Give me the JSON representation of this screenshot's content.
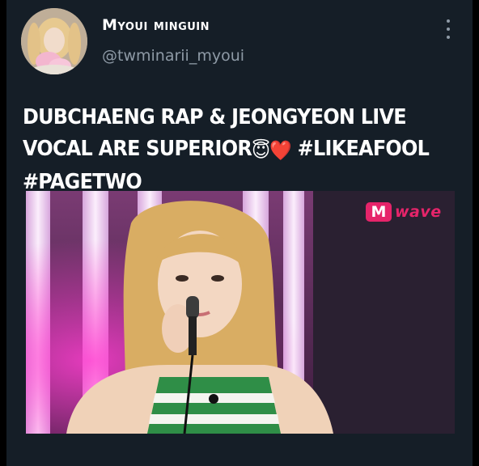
{
  "tweet": {
    "author": {
      "display_name": "Myoui minguin",
      "handle": "@twminarii_myoui"
    },
    "text_parts": [
      "DUBCHAENG RAP & JEONGYEON LIVE VOCAL ARE SUPERIOR",
      "😇",
      "❤️",
      " #LIKEAFOOL #PAGETWO"
    ],
    "media": {
      "watermark_logo": "M",
      "watermark_word": "wave"
    }
  },
  "icons": {
    "more": "more-vertical-icon",
    "avatar": "avatar-image"
  },
  "colors": {
    "background": "#151e27",
    "text_primary": "#ffffff",
    "text_secondary": "#8e9aa6",
    "watermark": "#e6246a"
  }
}
